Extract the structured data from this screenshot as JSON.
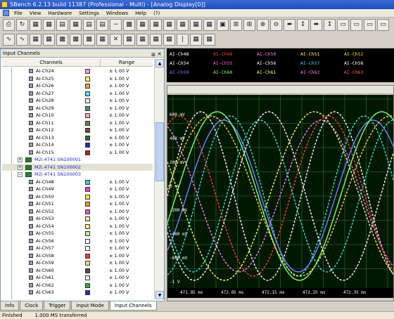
{
  "window": {
    "title": "SBench 6.2.13 build 11387 (Professional - Multi) - [Analog Display[0]]"
  },
  "menu": [
    "File",
    "View",
    "Hardware",
    "Settings",
    "Windows",
    "Help",
    "(?)"
  ],
  "left_panel": {
    "title": "Input Channels",
    "pin_glyph": "⊞",
    "close_glyph": "×",
    "col_channels": "Channels",
    "col_range": "Range",
    "rows": [
      {
        "kind": "channel",
        "name": "AI-Ch24",
        "color": "#ff9be0",
        "range": "± 1.00 V"
      },
      {
        "kind": "channel",
        "name": "AI-Ch25",
        "color": "#ffff66",
        "range": "± 1.00 V"
      },
      {
        "kind": "channel",
        "name": "AI-Ch26",
        "color": "#f0a24a",
        "range": "± 1.00 V"
      },
      {
        "kind": "channel",
        "name": "AI-Ch27",
        "color": "#66ddee",
        "range": "± 1.00 V"
      },
      {
        "kind": "channel",
        "name": "AI-Ch28",
        "color": "#eeeeee",
        "range": "± 1.00 V"
      },
      {
        "kind": "channel",
        "name": "AI-Ch29",
        "color": "#4a8a88",
        "range": "± 1.00 V"
      },
      {
        "kind": "channel",
        "name": "AI-Ch10",
        "color": "#f4a6b0",
        "range": "± 1.00 V"
      },
      {
        "kind": "channel",
        "name": "AI-Ch11",
        "color": "#5a8a42",
        "range": "± 1.00 V"
      },
      {
        "kind": "channel",
        "name": "AI-Ch12",
        "color": "#6a4a3a",
        "range": "± 1.00 V"
      },
      {
        "kind": "channel",
        "name": "AI-Ch13",
        "color": "#2e6e2e",
        "range": "± 1.00 V"
      },
      {
        "kind": "channel",
        "name": "AI-Ch14",
        "color": "#2a2ab0",
        "range": "± 1.00 V"
      },
      {
        "kind": "channel",
        "name": "AI-Ch15",
        "color": "#a02a2a",
        "range": "± 1.00 V"
      },
      {
        "kind": "group",
        "name": "M2i.4741 SN100001",
        "expand": "+"
      },
      {
        "kind": "group",
        "name": "M2i.4741 SN100002",
        "expand": "+",
        "selected": true
      },
      {
        "kind": "group",
        "name": "M2i.4741 SN100003",
        "expand": "−"
      },
      {
        "kind": "channel",
        "name": "AI-Ch48",
        "color": "#44c8c8",
        "range": "± 1.00 V"
      },
      {
        "kind": "channel",
        "name": "AI-Ch49",
        "color": "#e040e0",
        "range": "± 1.00 V"
      },
      {
        "kind": "channel",
        "name": "AI-Ch50",
        "color": "#f0f040",
        "range": "± 1.00 V"
      },
      {
        "kind": "channel",
        "name": "AI-Ch51",
        "color": "#f09a30",
        "range": "± 1.00 V"
      },
      {
        "kind": "channel",
        "name": "AI-Ch52",
        "color": "#e060b0",
        "range": "± 1.00 V"
      },
      {
        "kind": "channel",
        "name": "AI-Ch53",
        "color": "#f0e8a0",
        "range": "± 1.00 V"
      },
      {
        "kind": "channel",
        "name": "AI-Ch54",
        "color": "#ffff88",
        "range": "± 1.00 V"
      },
      {
        "kind": "channel",
        "name": "AI-Ch55",
        "color": "#c0e8a0",
        "range": "± 1.00 V"
      },
      {
        "kind": "channel",
        "name": "AI-Ch56",
        "color": "#ffffff",
        "range": "± 1.00 V"
      },
      {
        "kind": "channel",
        "name": "AI-Ch57",
        "color": "#ffffff",
        "range": "± 1.00 V"
      },
      {
        "kind": "channel",
        "name": "AI-Ch58",
        "color": "#e04040",
        "range": "± 1.00 V"
      },
      {
        "kind": "channel",
        "name": "AI-Ch59",
        "color": "#e0e080",
        "range": "± 1.00 V"
      },
      {
        "kind": "channel",
        "name": "AI-Ch60",
        "color": "#4a4a4a",
        "range": "± 1.00 V"
      },
      {
        "kind": "channel",
        "name": "AI-Ch61",
        "color": "#eeeeee",
        "range": "± 1.00 V"
      },
      {
        "kind": "channel",
        "name": "AI-Ch62",
        "color": "#40a040",
        "range": "± 1.00 V"
      },
      {
        "kind": "channel",
        "name": "AI-Ch63",
        "color": "#2a2ab0",
        "range": "± 1.00 V"
      }
    ]
  },
  "tabs": [
    "Info",
    "Clock",
    "Trigger",
    "Input Mode",
    "Input Channels"
  ],
  "active_tab": "Input Channels",
  "status": "Finished        1.000 MS transferred",
  "legend": [
    {
      "label": "AI-Ch48",
      "color": "#ffffff"
    },
    {
      "label": "AI-Ch49",
      "color": "#ff4040"
    },
    {
      "label": "AI-Ch50",
      "color": "#ff80ff"
    },
    {
      "label": "AI-Ch51",
      "color": "#ffff60"
    },
    {
      "label": "AI-Ch52",
      "color": "#ffdd44"
    },
    {
      "label": "AI-Ch54",
      "color": "#ffffff"
    },
    {
      "label": "AI-Ch55",
      "color": "#ff60c0"
    },
    {
      "label": "AI-Ch56",
      "color": "#ffffff"
    },
    {
      "label": "AI-Ch57",
      "color": "#40e0e0"
    },
    {
      "label": "AI-Ch58",
      "color": "#ffffff"
    },
    {
      "label": "AI-Ch59",
      "color": "#8080ff"
    },
    {
      "label": "AI-Ch60",
      "color": "#80ff80"
    },
    {
      "label": "AI-Ch61",
      "color": "#ffff80"
    },
    {
      "label": "AI-Ch62",
      "color": "#ff80ff"
    },
    {
      "label": "AI-Ch63",
      "color": "#ff6060"
    }
  ],
  "scope": {
    "y_labels": [
      "600 mV",
      "400 mV",
      "200 mV",
      "0 mV",
      "-200 mV",
      "-400 mV",
      "-600 mV",
      "-1 V"
    ],
    "x_labels": [
      "471.95 ms",
      "472.05 ms",
      "472.15 ms",
      "472.25 ms",
      "472.35 ms"
    ],
    "waves": [
      {
        "color": "#ffffff",
        "dash": true
      },
      {
        "color": "#ff4040",
        "dash": true
      },
      {
        "color": "#ff80ff",
        "dash": true
      },
      {
        "color": "#ffff60",
        "dash": true
      },
      {
        "color": "#40e0e0",
        "dash": true
      },
      {
        "color": "#8080ff",
        "dash": false
      },
      {
        "color": "#80ff80",
        "dash": false
      },
      {
        "color": "#ffdd44",
        "dash": true
      },
      {
        "color": "#40e0e0",
        "dash": true
      },
      {
        "color": "#ffffff",
        "dash": true
      }
    ]
  }
}
